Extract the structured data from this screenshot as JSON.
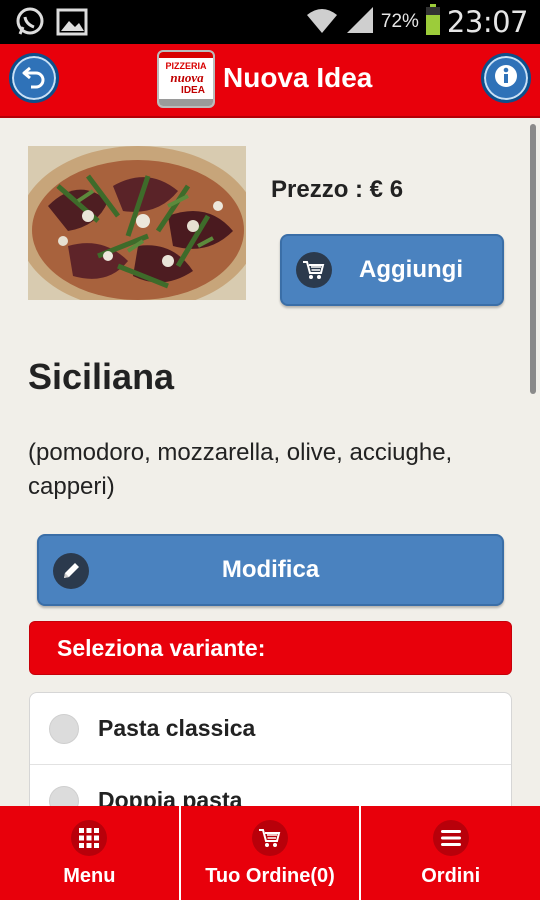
{
  "status_bar": {
    "battery_percent": "72%",
    "time": "23:07"
  },
  "header": {
    "title": "Nuova Idea",
    "logo_text_top": "PIZZERIA",
    "logo_text_mid": "nuova",
    "logo_text_bottom": "IDEA"
  },
  "product": {
    "price_label": "Prezzo : € 6",
    "add_button": "Aggiungi",
    "name": "Siciliana",
    "description": "(pomodoro, mozzarella, olive, acciughe, capperi)",
    "edit_button": "Modifica"
  },
  "variants": {
    "title": "Seleziona variante:",
    "options": [
      {
        "label": "Pasta classica"
      },
      {
        "label": "Doppia pasta"
      }
    ]
  },
  "bottom_nav": {
    "items": [
      {
        "label": "Menu",
        "icon": "grid-icon"
      },
      {
        "label": "Tuo Ordine(0)",
        "icon": "cart-icon"
      },
      {
        "label": "Ordini",
        "icon": "list-icon"
      }
    ]
  },
  "colors": {
    "brand_red": "#e8000b",
    "button_blue": "#4a82bf"
  }
}
